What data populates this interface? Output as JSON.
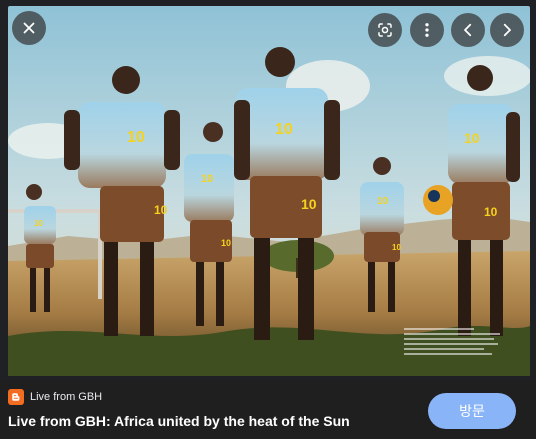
{
  "viewer": {
    "close_icon": "close-icon",
    "lens_icon": "google-lens-icon",
    "more_icon": "more-vert-icon",
    "prev_icon": "chevron-left-icon",
    "next_icon": "chevron-right-icon"
  },
  "photo": {
    "jersey_number": "10"
  },
  "result": {
    "source_name": "Live from GBH",
    "source_icon": "blogger-icon",
    "title": "Live from GBH: Africa united by the heat of the Sun",
    "visit_label": "방문"
  },
  "colors": {
    "accent": "#8ab4f8",
    "blogger": "#f26d21",
    "background": "#1f1f1f"
  }
}
